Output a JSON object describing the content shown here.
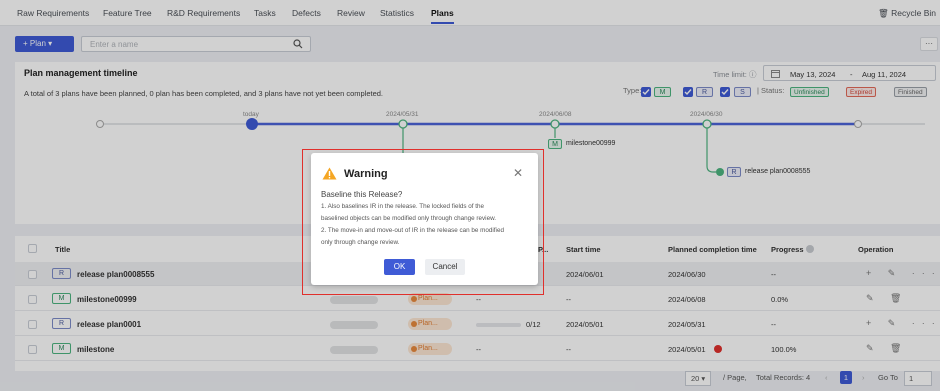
{
  "tabs": [
    "Raw Requirements",
    "Feature Tree",
    "R&D Requirements",
    "Tasks",
    "Defects",
    "Review",
    "Statistics",
    "Plans"
  ],
  "recycle_label": "Recycle Bin",
  "toolbar": {
    "plan_button": "+ Plan ▾",
    "search_placeholder": "Enter a name",
    "more": "···"
  },
  "panel": {
    "title": "Plan management timeline",
    "summary": "A total of 3 plans have been planned, 0 plan has been completed, and 3 plans have not yet been completed.",
    "time_limit_label": "Time limit: ⓘ",
    "date_start": "May 13, 2024",
    "date_sep": "-",
    "date_end": "Aug 11, 2024",
    "type_label": "Type:",
    "type_tags": [
      "M",
      "R",
      "S"
    ],
    "status_label": "| Status:",
    "statuses": [
      "Unfinished",
      "Expired",
      "Finished"
    ]
  },
  "timeline": {
    "labels": [
      "today",
      "2024/05/31",
      "2024/06/08",
      "2024/06/30"
    ],
    "milestone_tag": "M",
    "milestone_name": "milestone00999",
    "release_tag": "R",
    "release_name": "release plan0008555"
  },
  "table": {
    "headers": [
      "Title",
      "P...",
      "Start time",
      "Planned completion time",
      "Progress",
      "Operation"
    ],
    "rows": [
      {
        "tag": "R",
        "title": "release plan0008555",
        "status": "",
        "start": "2024/06/01",
        "planned": "2024/06/30",
        "progress": "--",
        "ops": "+ ✎ ···"
      },
      {
        "tag": "M",
        "title": "milestone00999",
        "status": "Plan...",
        "start": "--",
        "planned": "2024/06/08",
        "progress": "0.0%",
        "ops": "✎ 🗑",
        "phase": "--"
      },
      {
        "tag": "R",
        "title": "release plan0001",
        "status": "Plan...",
        "start": "2024/05/01",
        "planned": "2024/05/31",
        "progress": "--",
        "ops": "+ ✎ ···",
        "phase": "0/12"
      },
      {
        "tag": "M",
        "title": "milestone",
        "status": "Plan...",
        "start": "--",
        "planned": "2024/05/01",
        "progress": "100.0%",
        "ops": "✎ 🗑",
        "phase": "--"
      }
    ]
  },
  "pager": {
    "size": "20 ▾",
    "per_page": "/ Page,",
    "total": "Total Records: 4",
    "page": "1",
    "goto": "Go To",
    "goto_val": "1"
  },
  "dialog": {
    "title": "Warning",
    "question": "Baseline this Release?",
    "lines": [
      "1. Also baselines IR in the release. The locked fields of the",
      "baselined objects can be modified only through change review.",
      "2. The move-in and move-out of IR in the release can be modified",
      "only through change review."
    ],
    "ok": "OK",
    "cancel": "Cancel"
  }
}
